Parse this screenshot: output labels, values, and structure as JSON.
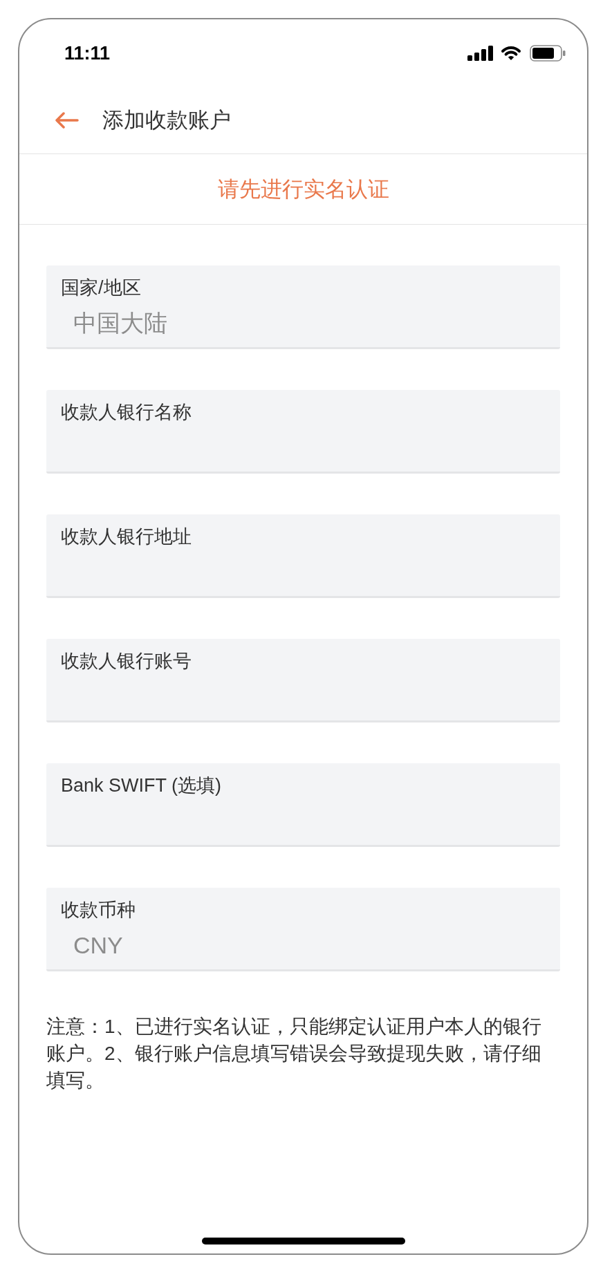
{
  "status_bar": {
    "time": "11:11"
  },
  "header": {
    "title": "添加收款账户"
  },
  "banner": {
    "text": "请先进行实名认证"
  },
  "fields": [
    {
      "label": "国家/地区",
      "value": "中国大陆"
    },
    {
      "label": "收款人银行名称"
    },
    {
      "label": "收款人银行地址"
    },
    {
      "label": "收款人银行账号"
    },
    {
      "label": "Bank SWIFT (选填)"
    },
    {
      "label": "收款币种",
      "value": "CNY"
    }
  ],
  "note": "注意：1、已进行实名认证，只能绑定认证用户本人的银行账户。2、银行账户信息填写错误会导致提现失败，请仔细填写。"
}
